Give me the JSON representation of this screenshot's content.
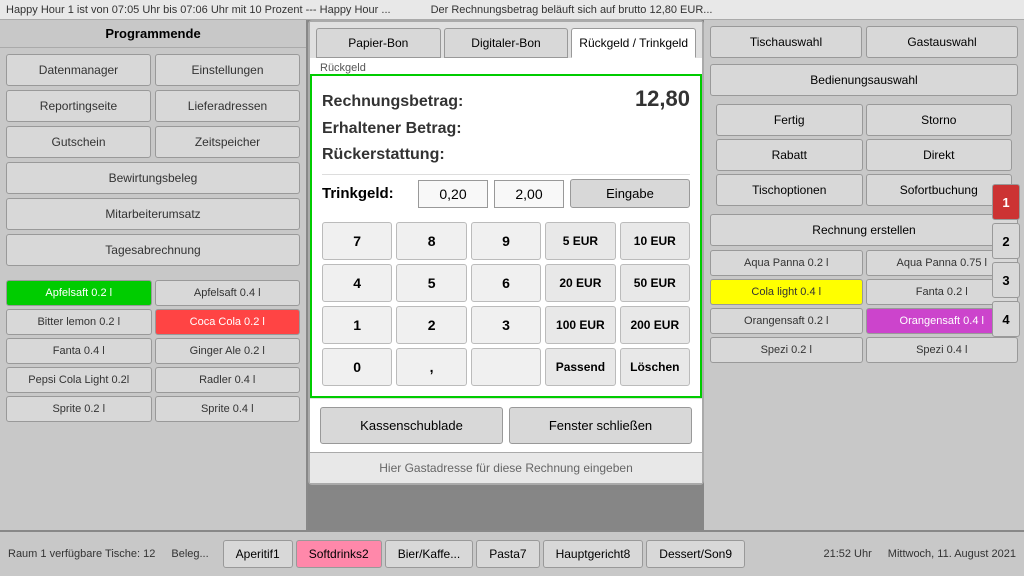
{
  "ticker": {
    "left": "Happy Hour 1 ist von 07:05 Uhr bis 07:06 Uhr mit 10 Prozent --- Happy Hour ...",
    "right": "Der Rechnungsbetrag beläuft sich auf brutto 12,80 EUR..."
  },
  "left_panel": {
    "title": "Programmende",
    "menu_buttons": [
      {
        "label": "Datenmanager",
        "col": 1
      },
      {
        "label": "Einstellungen",
        "col": 2
      },
      {
        "label": "Reportingseite",
        "col": 1
      },
      {
        "label": "Lieferadressen",
        "col": 2
      },
      {
        "label": "Gutschein",
        "col": 1
      },
      {
        "label": "Zeitspeicher",
        "col": 2
      },
      {
        "label": "Bewirtungsbeleg",
        "full": true
      },
      {
        "label": "Mitarbeiterumsatz",
        "full": true
      },
      {
        "label": "Tagesabrechnung",
        "full": true
      }
    ],
    "items": [
      {
        "label": "Apfelsaft 0.2 l",
        "style": "green"
      },
      {
        "label": "Apfelsaft 0.4 l",
        "style": "normal"
      },
      {
        "label": "Bitter lemon 0.2 l",
        "style": "normal"
      },
      {
        "label": "Coca Cola 0.2 l",
        "style": "red"
      },
      {
        "label": "Fanta 0.4 l",
        "style": "normal"
      },
      {
        "label": "Ginger Ale 0.2 l",
        "style": "normal"
      },
      {
        "label": "Pepsi Cola Light 0.2l",
        "style": "normal"
      },
      {
        "label": "Radler 0.4 l",
        "style": "normal"
      },
      {
        "label": "Sprite 0.2 l",
        "style": "normal"
      },
      {
        "label": "Sprite 0.4 l",
        "style": "normal"
      }
    ]
  },
  "right_panel": {
    "top_buttons": [
      {
        "label": "Tischauswahl"
      },
      {
        "label": "Gastauswahl"
      }
    ],
    "bedienung": "Bedienungsauswahl",
    "action_buttons": [
      {
        "label": "Fertig"
      },
      {
        "label": "Storno"
      },
      {
        "label": "Rabatt"
      },
      {
        "label": "Direkt"
      },
      {
        "label": "Tischoptionen"
      },
      {
        "label": "Sofortbuchung"
      }
    ],
    "rechnung": "Rechnung erstellen",
    "items": [
      {
        "label": "Aqua Panna 0.2 l",
        "style": "normal"
      },
      {
        "label": "Aqua Panna 0.75 l",
        "style": "normal"
      },
      {
        "label": "Cola light 0.4 l",
        "style": "yellow"
      },
      {
        "label": "Fanta 0.2 l",
        "style": "normal"
      },
      {
        "label": "Orangensaft 0.2 l",
        "style": "normal"
      },
      {
        "label": "Orangensaft 0.4 l",
        "style": "magenta"
      },
      {
        "label": "Spezi 0.2 l",
        "style": "normal"
      },
      {
        "label": "Spezi 0.4 l",
        "style": "normal"
      }
    ],
    "number_tabs": [
      "1",
      "2",
      "3",
      "4"
    ]
  },
  "modal": {
    "tabs": [
      {
        "label": "Papier-Bon"
      },
      {
        "label": "Digitaler-Bon"
      },
      {
        "label": "Rückgeld / Trinkgeld"
      }
    ],
    "active_tab": "Rückgeld / Trinkgeld",
    "header_label": "Rückgeld",
    "invoice": {
      "label_betrag": "Rechnungsbetrag:",
      "amount": "12,80",
      "label_erhalten": "Erhaltener Betrag:",
      "label_rueck": "Rückerstattung:"
    },
    "trinkgeld": {
      "label": "Trinkgeld:",
      "value1": "0,20",
      "value2": "2,00",
      "eingabe": "Eingabe"
    },
    "numpad": {
      "digits": [
        "7",
        "8",
        "9",
        "4",
        "5",
        "6",
        "1",
        "2",
        "3",
        "0",
        ","
      ],
      "eur_buttons": [
        "5 EUR",
        "10 EUR",
        "20 EUR",
        "50 EUR",
        "100 EUR",
        "200 EUR"
      ],
      "special": [
        "Passend",
        "Löschen"
      ]
    },
    "bottom_buttons": [
      {
        "label": "Kassenschublade"
      },
      {
        "label": "Fenster schließen"
      }
    ],
    "address_bar": "Hier Gastadresse für diese Rechnung eingeben"
  },
  "bottom": {
    "tabs": [
      {
        "label": "Aperitif1",
        "style": "normal"
      },
      {
        "label": "Softdrinks2",
        "style": "pink"
      },
      {
        "label": "Bier/Kaffe...",
        "style": "normal"
      },
      {
        "label": "Pasta7",
        "style": "normal"
      },
      {
        "label": "Hauptgericht8",
        "style": "normal"
      },
      {
        "label": "Dessert/Son9",
        "style": "normal"
      }
    ],
    "status_left": "Raum 1 verfügbare Tische: 12",
    "status_beleg": "Beleg...",
    "status_time": "21:52 Uhr",
    "status_date": "Mittwoch, 11. August 2021"
  }
}
